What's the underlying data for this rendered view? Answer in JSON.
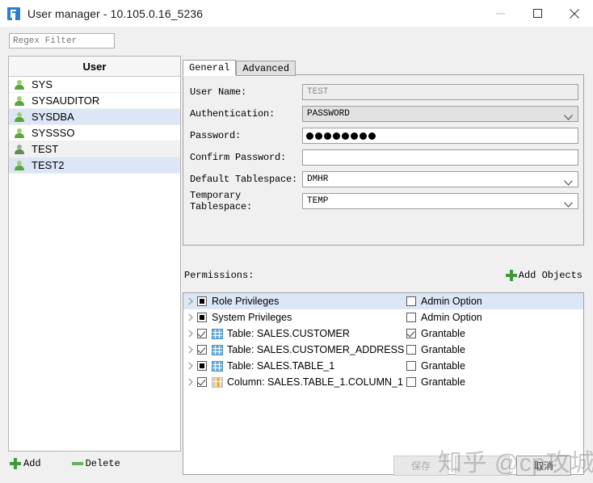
{
  "window": {
    "title": "User manager - 10.105.0.16_5236",
    "icon": "app-icon",
    "minimize_label": "minimize",
    "maximize_label": "maximize",
    "close_label": "close"
  },
  "sidebar": {
    "filter_placeholder": "Regex Filter",
    "filter_value": "",
    "column_header": "User",
    "users": [
      {
        "name": "SYS",
        "state": "normal"
      },
      {
        "name": "SYSAUDITOR",
        "state": "normal"
      },
      {
        "name": "SYSDBA",
        "state": "selected"
      },
      {
        "name": "SYSSSO",
        "state": "normal"
      },
      {
        "name": "TEST",
        "state": "alt"
      },
      {
        "name": "TEST2",
        "state": "selected"
      }
    ],
    "add_label": "Add",
    "delete_label": "Delete"
  },
  "tabs": [
    {
      "label": "General",
      "active": true
    },
    {
      "label": "Advanced",
      "active": false
    }
  ],
  "form": {
    "user_name": {
      "label": "User Name:",
      "value": "TEST",
      "readonly": true
    },
    "authentication": {
      "label": "Authentication:",
      "value": "PASSWORD"
    },
    "password": {
      "label": "Password:",
      "dots": 8
    },
    "confirm_password": {
      "label": "Confirm Password:",
      "value": ""
    },
    "default_tablespace": {
      "label": "Default Tablespace:",
      "value": "DMHR"
    },
    "temporary_tablespace": {
      "label": "Temporary Tablespace:",
      "value": "TEMP"
    }
  },
  "permissions": {
    "label": "Permissions:",
    "add_objects_label": "Add Objects",
    "rows": [
      {
        "name": "Role Privileges",
        "check": "partial",
        "icon": "none",
        "option_label": "Admin Option",
        "option_check": "off",
        "selected": true
      },
      {
        "name": "System Privileges",
        "check": "partial",
        "icon": "none",
        "option_label": "Admin Option",
        "option_check": "off",
        "selected": false
      },
      {
        "name": "Table: SALES.CUSTOMER",
        "check": "checked",
        "icon": "table",
        "option_label": "Grantable",
        "option_check": "checked",
        "selected": false
      },
      {
        "name": "Table: SALES.CUSTOMER_ADDRESS",
        "check": "checked",
        "icon": "table",
        "option_label": "Grantable",
        "option_check": "off",
        "selected": false
      },
      {
        "name": "Table: SALES.TABLE_1",
        "check": "partial",
        "icon": "table",
        "option_label": "Grantable",
        "option_check": "off",
        "selected": false
      },
      {
        "name": "Column: SALES.TABLE_1.COLUMN_1",
        "check": "checked",
        "icon": "column",
        "option_label": "Grantable",
        "option_check": "off",
        "selected": false
      }
    ]
  },
  "footer": {
    "save_label": "保存",
    "middle_label": "",
    "cancel_label": "取消"
  },
  "watermark": {
    "text": "知乎 @cp攻城师"
  },
  "colors": {
    "selection_blue": "#dce6f7",
    "accent_green": "#3c9a3c",
    "window_bg": "#f0f0f0"
  }
}
